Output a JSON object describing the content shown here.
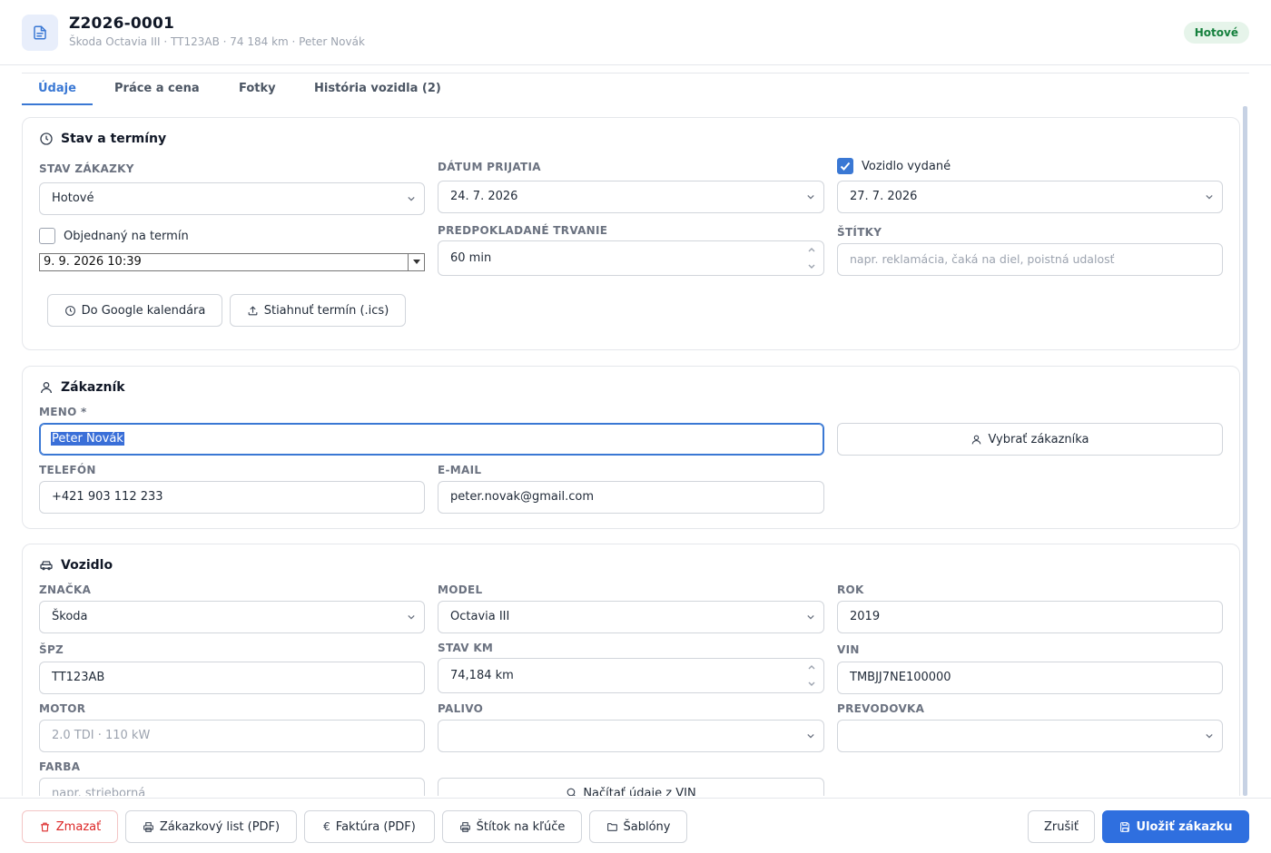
{
  "header": {
    "title": "Z2026-0001",
    "subtitle": "Škoda Octavia III · TT123AB · 74 184 km · Peter Novák",
    "status": "Hotové"
  },
  "tabs": [
    {
      "label": "Údaje",
      "active": true
    },
    {
      "label": "Práce a cena",
      "active": false
    },
    {
      "label": "Fotky",
      "active": false
    },
    {
      "label": "História vozidla (2)",
      "active": false
    }
  ],
  "stav": {
    "title": "Stav a termíny",
    "stav_label": "STAV ZÁKAZKY",
    "stav_value": "Hotové",
    "objednany_label": "Objednaný na termín",
    "objednany_checked": false,
    "termin_value": "9. 9. 2026  10:39",
    "datum_label": "DÁTUM PRIJATIA",
    "datum_value": "24. 7. 2026",
    "trvanie_label": "PREDPOKLADANÉ TRVANIE",
    "trvanie_value": "60 min",
    "vydane_label": "Vozidlo vydané",
    "vydane_checked": true,
    "vydane_value": "27. 7. 2026",
    "stitky_label": "ŠTÍTKY",
    "stitky_placeholder": "napr. reklamácia, čaká na diel, poistná udalosť",
    "google_btn": "Do Google kalendára",
    "ics_btn": "Stiahnuť termín (.ics)"
  },
  "zakaznik": {
    "title": "Zákazník",
    "meno_label": "MENO *",
    "meno_value": "Peter Novák",
    "vybrat_btn": "Vybrať zákazníka",
    "telefon_label": "TELEFÓN",
    "telefon_value": "+421 903 112 233",
    "email_label": "E-MAIL",
    "email_value": "peter.novak@gmail.com"
  },
  "vozidlo": {
    "title": "Vozidlo",
    "znacka_label": "ZNAČKA",
    "znacka_value": "Škoda",
    "model_label": "MODEL",
    "model_value": "Octavia III",
    "rok_label": "ROK",
    "rok_value": "2019",
    "spz_label": "ŠPZ",
    "spz_value": "TT123AB",
    "km_label": "STAV KM",
    "km_value": "74,184 km",
    "vin_label": "VIN",
    "vin_value": "TMBJJ7NE100000",
    "motor_label": "MOTOR",
    "motor_placeholder": "2.0 TDI · 110 kW",
    "palivo_label": "PALIVO",
    "palivo_value": "",
    "prevodovka_label": "PREVODOVKA",
    "prevodovka_value": "",
    "farba_label": "FARBA",
    "farba_placeholder": "napr. strieborná",
    "vin_btn": "Načítať údaje z VIN"
  },
  "footer": {
    "delete": "Zmazať",
    "zakazkovy_list": "Zákazkový list (PDF)",
    "faktura": "Faktúra (PDF)",
    "stitok": "Štítok na kľúče",
    "sablony": "Šablóny",
    "cancel": "Zrušiť",
    "save": "Uložiť zákazku"
  },
  "colors": {
    "accent": "#3a78d4",
    "primary_button": "#2f6fdf",
    "status_bg": "#e6f4ea",
    "status_text": "#15803d",
    "danger": "#dc2626"
  }
}
